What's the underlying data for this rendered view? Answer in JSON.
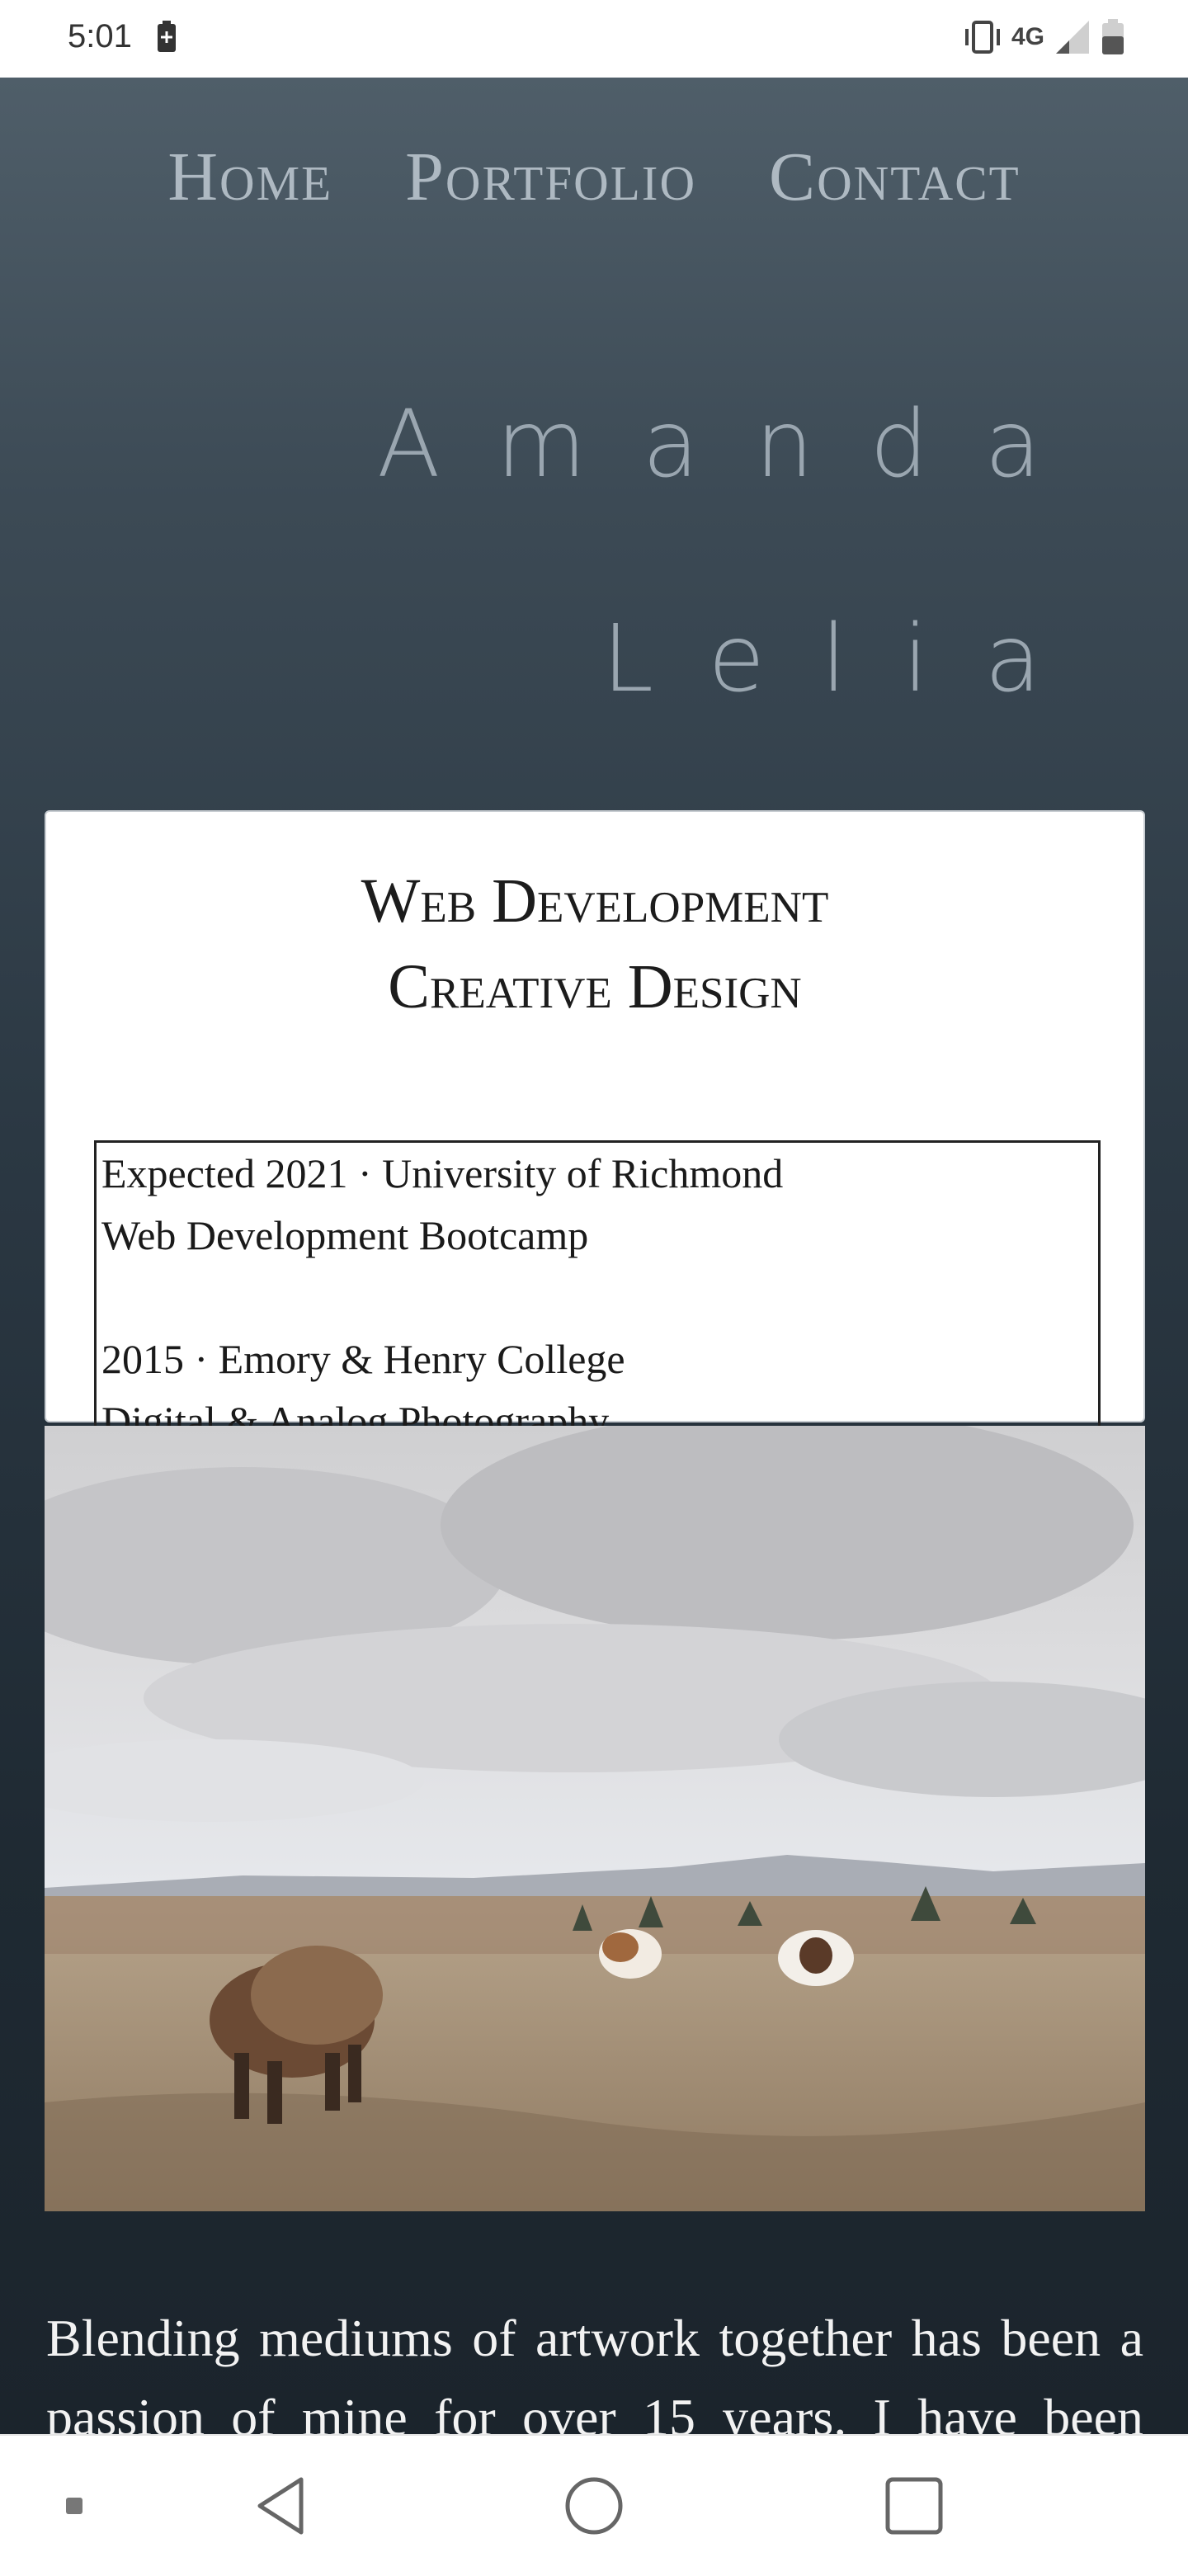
{
  "status_bar": {
    "time": "5:01",
    "network_label": "4G",
    "icons": [
      "battery-saver-icon",
      "vibrate-icon",
      "signal-icon",
      "battery-icon"
    ]
  },
  "nav": {
    "items": [
      {
        "label": "Home"
      },
      {
        "label": "Portfolio"
      },
      {
        "label": "Contact"
      }
    ]
  },
  "hero": {
    "first_name": "Amanda",
    "last_name": "Lelia"
  },
  "card": {
    "title_line1": "Web Development",
    "title_line2": "Creative Design",
    "education": [
      {
        "line1": "Expected 2021 · University of Richmond",
        "line2": "Web Development Bootcamp"
      },
      {
        "line1": "2015 · Emory & Henry College",
        "line2": "Digital & Analog Photography"
      }
    ]
  },
  "photo": {
    "subject": "ponies grazing on a grassy hilltop under a cloudy sky"
  },
  "intro": {
    "text": "Blending mediums of artwork together has been a passion of mine for over 15 years. I have been taking yellow pixels highschool for"
  },
  "android_nav": {
    "buttons": [
      "recents-dot-icon",
      "back-icon",
      "home-icon",
      "overview-icon"
    ]
  },
  "colors": {
    "page_top": "#4f5e69",
    "page_bottom": "#1b242c",
    "nav_text": "#aeb9c2",
    "hero_text": "#9aa6b0",
    "card_bg": "#ffffff"
  }
}
